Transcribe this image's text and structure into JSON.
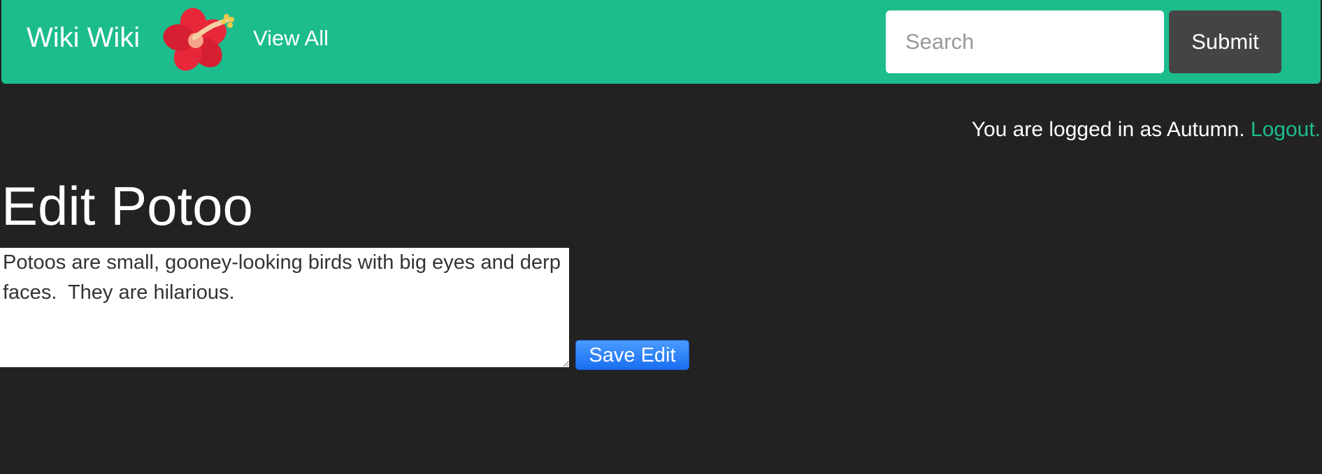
{
  "navbar": {
    "brand": "Wiki Wiki",
    "logo_icon": "hibiscus-flower-icon",
    "view_all_label": "View All",
    "search_placeholder": "Search",
    "search_value": "",
    "submit_label": "Submit",
    "background_color": "#1dbc8d"
  },
  "session": {
    "status_text": "You are logged in as Autumn.",
    "logout_label": "Logout."
  },
  "main": {
    "title": "Edit Potoo",
    "content": "Potoos are small, gooney-looking birds with big eyes and derp faces.  They are hilarious.",
    "save_label": "Save Edit"
  }
}
